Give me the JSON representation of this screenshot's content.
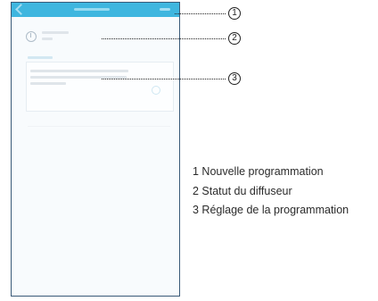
{
  "callouts": [
    {
      "number": "1"
    },
    {
      "number": "2"
    },
    {
      "number": "3"
    }
  ],
  "legend": {
    "items": [
      "1 Nouvelle programmation",
      "2 Statut du diffuseur",
      "3 Réglage de la programmation"
    ]
  },
  "colors": {
    "header": "#3fb6df",
    "frame": "#3a5a78"
  },
  "icons": [
    "back-icon",
    "add-icon",
    "clock-icon",
    "edit-icon"
  ]
}
